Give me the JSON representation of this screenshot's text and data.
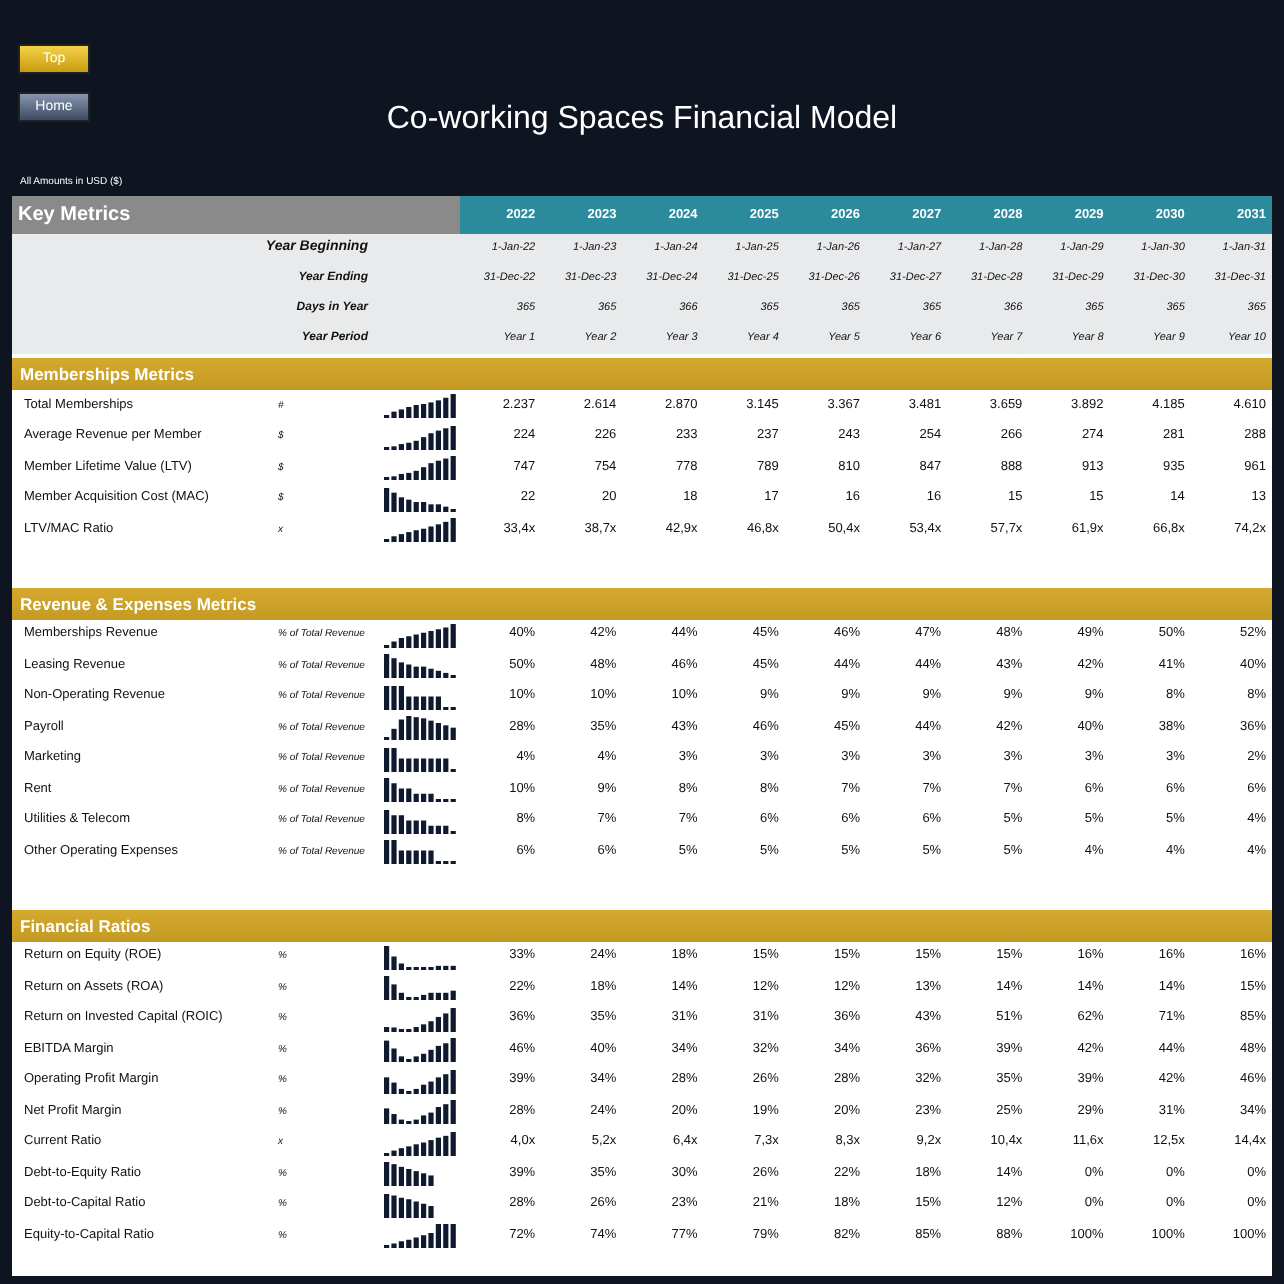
{
  "buttons": [
    {
      "label": "Top",
      "kind": "gold"
    },
    {
      "label": "Home",
      "kind": "slate"
    }
  ],
  "title": "Co-working Spaces Financial Model",
  "currency_note": "All Amounts in  USD ($)",
  "key_metrics": {
    "title": "Key Metrics",
    "years": [
      "2022",
      "2023",
      "2024",
      "2025",
      "2026",
      "2027",
      "2028",
      "2029",
      "2030",
      "2031"
    ],
    "info_rows": [
      {
        "label": "Year Beginning",
        "kind": "main",
        "values": [
          "1-Jan-22",
          "1-Jan-23",
          "1-Jan-24",
          "1-Jan-25",
          "1-Jan-26",
          "1-Jan-27",
          "1-Jan-28",
          "1-Jan-29",
          "1-Jan-30",
          "1-Jan-31"
        ]
      },
      {
        "label": "Year Ending",
        "kind": "sub",
        "values": [
          "31-Dec-22",
          "31-Dec-23",
          "31-Dec-24",
          "31-Dec-25",
          "31-Dec-26",
          "31-Dec-27",
          "31-Dec-28",
          "31-Dec-29",
          "31-Dec-30",
          "31-Dec-31"
        ]
      },
      {
        "label": "Days in Year",
        "kind": "sub",
        "values": [
          "365",
          "365",
          "366",
          "365",
          "365",
          "365",
          "366",
          "365",
          "365",
          "365"
        ]
      },
      {
        "label": "Year Period",
        "kind": "sub",
        "values": [
          "Year 1",
          "Year 2",
          "Year 3",
          "Year 4",
          "Year 5",
          "Year 6",
          "Year 7",
          "Year 8",
          "Year 9",
          "Year 10"
        ]
      }
    ]
  },
  "sections": [
    {
      "title": "Memberships Metrics",
      "rows": [
        {
          "label": "Total Memberships",
          "unit": "#",
          "values": [
            "2.237",
            "2.614",
            "2.870",
            "3.145",
            "3.367",
            "3.481",
            "3.659",
            "3.892",
            "4.185",
            "4.610"
          ]
        },
        {
          "label": "Average Revenue per Member",
          "unit": "$",
          "values": [
            "224",
            "226",
            "233",
            "237",
            "243",
            "254",
            "266",
            "274",
            "281",
            "288"
          ]
        },
        {
          "label": "Member Lifetime Value (LTV)",
          "unit": "$",
          "values": [
            "747",
            "754",
            "778",
            "789",
            "810",
            "847",
            "888",
            "913",
            "935",
            "961"
          ]
        },
        {
          "label": "Member Acquisition Cost (MAC)",
          "unit": "$",
          "values": [
            "22",
            "20",
            "18",
            "17",
            "16",
            "16",
            "15",
            "15",
            "14",
            "13"
          ]
        },
        {
          "label": "LTV/MAC Ratio",
          "unit": "x",
          "values": [
            "33,4x",
            "38,7x",
            "42,9x",
            "46,8x",
            "50,4x",
            "53,4x",
            "57,7x",
            "61,9x",
            "66,8x",
            "74,2x"
          ]
        }
      ]
    },
    {
      "title": "Revenue & Expenses Metrics",
      "rows": [
        {
          "label": "Memberships Revenue",
          "unit": "% of Total Revenue",
          "values": [
            "40%",
            "42%",
            "44%",
            "45%",
            "46%",
            "47%",
            "48%",
            "49%",
            "50%",
            "52%"
          ]
        },
        {
          "label": "Leasing Revenue",
          "unit": "% of Total Revenue",
          "values": [
            "50%",
            "48%",
            "46%",
            "45%",
            "44%",
            "44%",
            "43%",
            "42%",
            "41%",
            "40%"
          ]
        },
        {
          "label": "Non-Operating Revenue",
          "unit": "% of Total Revenue",
          "values": [
            "10%",
            "10%",
            "10%",
            "9%",
            "9%",
            "9%",
            "9%",
            "9%",
            "8%",
            "8%"
          ]
        },
        {
          "label": "Payroll",
          "unit": "% of Total Revenue",
          "values": [
            "28%",
            "35%",
            "43%",
            "46%",
            "45%",
            "44%",
            "42%",
            "40%",
            "38%",
            "36%"
          ]
        },
        {
          "label": "Marketing",
          "unit": "% of Total Revenue",
          "values": [
            "4%",
            "4%",
            "3%",
            "3%",
            "3%",
            "3%",
            "3%",
            "3%",
            "3%",
            "2%"
          ]
        },
        {
          "label": "Rent",
          "unit": "% of Total Revenue",
          "values": [
            "10%",
            "9%",
            "8%",
            "8%",
            "7%",
            "7%",
            "7%",
            "6%",
            "6%",
            "6%"
          ]
        },
        {
          "label": "Utilities & Telecom",
          "unit": "% of Total Revenue",
          "values": [
            "8%",
            "7%",
            "7%",
            "6%",
            "6%",
            "6%",
            "5%",
            "5%",
            "5%",
            "4%"
          ]
        },
        {
          "label": "Other Operating Expenses",
          "unit": "% of Total Revenue",
          "values": [
            "6%",
            "6%",
            "5%",
            "5%",
            "5%",
            "5%",
            "5%",
            "4%",
            "4%",
            "4%"
          ]
        }
      ]
    },
    {
      "title": "Financial Ratios",
      "rows": [
        {
          "label": "Return on Equity (ROE)",
          "unit": "%",
          "values": [
            "33%",
            "24%",
            "18%",
            "15%",
            "15%",
            "15%",
            "15%",
            "16%",
            "16%",
            "16%"
          ]
        },
        {
          "label": "Return on Assets (ROA)",
          "unit": "%",
          "values": [
            "22%",
            "18%",
            "14%",
            "12%",
            "12%",
            "13%",
            "14%",
            "14%",
            "14%",
            "15%"
          ]
        },
        {
          "label": "Return on Invested Capital (ROIC)",
          "unit": "%",
          "values": [
            "36%",
            "35%",
            "31%",
            "31%",
            "36%",
            "43%",
            "51%",
            "62%",
            "71%",
            "85%"
          ]
        },
        {
          "label": "EBITDA Margin",
          "unit": "%",
          "values": [
            "46%",
            "40%",
            "34%",
            "32%",
            "34%",
            "36%",
            "39%",
            "42%",
            "44%",
            "48%"
          ]
        },
        {
          "label": "Operating Profit Margin",
          "unit": "%",
          "values": [
            "39%",
            "34%",
            "28%",
            "26%",
            "28%",
            "32%",
            "35%",
            "39%",
            "42%",
            "46%"
          ]
        },
        {
          "label": "Net Profit Margin",
          "unit": "%",
          "values": [
            "28%",
            "24%",
            "20%",
            "19%",
            "20%",
            "23%",
            "25%",
            "29%",
            "31%",
            "34%"
          ]
        },
        {
          "label": "Current Ratio",
          "unit": "x",
          "values": [
            "4,0x",
            "5,2x",
            "6,4x",
            "7,3x",
            "8,3x",
            "9,2x",
            "10,4x",
            "11,6x",
            "12,5x",
            "14,4x"
          ]
        },
        {
          "label": "Debt-to-Equity Ratio",
          "unit": "%",
          "values": [
            "39%",
            "35%",
            "30%",
            "26%",
            "22%",
            "18%",
            "14%",
            "0%",
            "0%",
            "0%"
          ]
        },
        {
          "label": "Debt-to-Capital Ratio",
          "unit": "%",
          "values": [
            "28%",
            "26%",
            "23%",
            "21%",
            "18%",
            "15%",
            "12%",
            "0%",
            "0%",
            "0%"
          ]
        },
        {
          "label": "Equity-to-Capital Ratio",
          "unit": "%",
          "values": [
            "72%",
            "74%",
            "77%",
            "79%",
            "82%",
            "85%",
            "88%",
            "100%",
            "100%",
            "100%"
          ]
        }
      ]
    }
  ]
}
